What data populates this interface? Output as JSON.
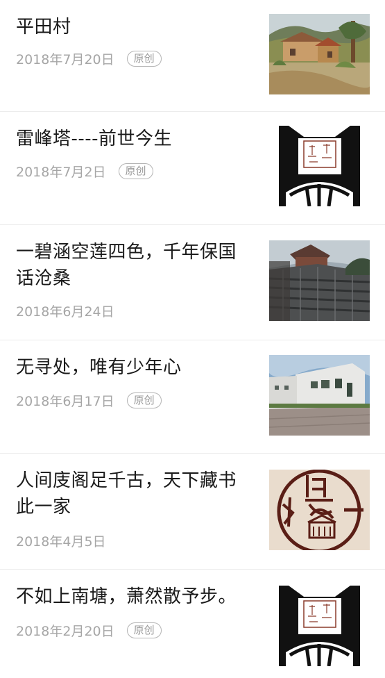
{
  "articles": [
    {
      "title": "平田村",
      "date": "2018年7月20日",
      "badge": "原创",
      "thumbnail": "village-painting"
    },
    {
      "title": "雷峰塔----前世今生",
      "date": "2018年7月2日",
      "badge": "原创",
      "thumbnail": "es-seal-logo"
    },
    {
      "title": "一碧涵空莲四色，千年保国话沧桑",
      "date": "2018年6月24日",
      "badge": "",
      "thumbnail": "temple-roof-photo"
    },
    {
      "title": "无寻处，唯有少年心",
      "date": "2018年6月17日",
      "badge": "原创",
      "thumbnail": "modern-building-photo"
    },
    {
      "title": "人间庋阁足千古，天下藏书此一家",
      "date": "2018年4月5日",
      "badge": "",
      "thumbnail": "library-seal-logo"
    },
    {
      "title": "不如上南塘，萧然散予步。",
      "date": "2018年2月20日",
      "badge": "原创",
      "thumbnail": "es-seal-logo"
    }
  ],
  "seal_text": "ES"
}
